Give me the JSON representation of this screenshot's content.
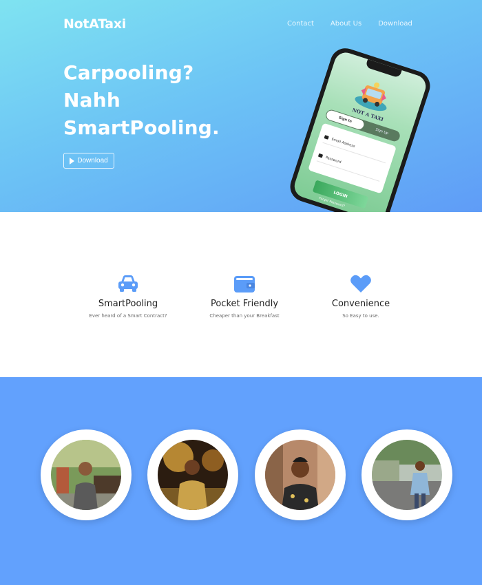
{
  "header": {
    "brand": "NotATaxi",
    "nav": [
      "Contact",
      "About Us",
      "Download"
    ]
  },
  "hero": {
    "headline": [
      "Carpooling?",
      "Nahh",
      "SmartPooling."
    ],
    "download_label": "Download"
  },
  "phone_app": {
    "name": "NOT A TAXI",
    "tab_signin": "Sign In",
    "tab_signup": "Sign Up",
    "email_placeholder": "Email Address",
    "password_placeholder": "Password",
    "login_label": "LOGIN",
    "forgot_label": "Forgot Password?"
  },
  "features": [
    {
      "icon": "car-icon",
      "title": "SmartPooling",
      "subtitle": "Ever heard of a Smart Contract?"
    },
    {
      "icon": "wallet-icon",
      "title": "Pocket Friendly",
      "subtitle": "Cheaper than your Breakfast"
    },
    {
      "icon": "heart-icon",
      "title": "Convenience",
      "subtitle": "So Easy to use."
    }
  ],
  "team": {
    "members": [
      {
        "icon": "team-member-photo"
      },
      {
        "icon": "team-member-photo"
      },
      {
        "icon": "team-member-photo"
      },
      {
        "icon": "team-member-photo"
      }
    ]
  },
  "colors": {
    "hero_gradient_start": "#7fe3f1",
    "hero_gradient_end": "#5f9cf7",
    "accent": "#5b9cf8",
    "team_bg": "#62a1fd",
    "app_green": "#3aa85c"
  }
}
